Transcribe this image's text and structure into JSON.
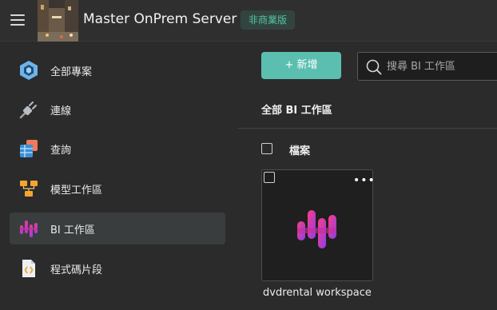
{
  "header": {
    "app_title": "Master OnPrem Server",
    "license_badge": "非商業版"
  },
  "sidebar": {
    "items": [
      {
        "label": "全部專案",
        "icon": "all-projects-icon",
        "active": false
      },
      {
        "label": "連線",
        "icon": "connection-plug-icon",
        "active": false
      },
      {
        "label": "查詢",
        "icon": "query-table-icon",
        "active": false
      },
      {
        "label": "模型工作區",
        "icon": "model-workspace-icon",
        "active": false
      },
      {
        "label": "BI 工作區",
        "icon": "bi-workspace-icon",
        "active": true
      },
      {
        "label": "程式碼片段",
        "icon": "code-snippet-icon",
        "active": false
      }
    ]
  },
  "main": {
    "new_button_label": "+ 新增",
    "search_placeholder": "搜尋 BI 工作區",
    "section_title": "全部 BI 工作區",
    "files_label": "檔案",
    "cards": [
      {
        "name": "dvdrental workspace",
        "menu": "•••"
      }
    ]
  },
  "colors": {
    "accent": "#5bbfb0",
    "badge_text": "#58c3a5",
    "bi_icon_gradient": [
      "#ff3d7f",
      "#8b3df0"
    ]
  }
}
